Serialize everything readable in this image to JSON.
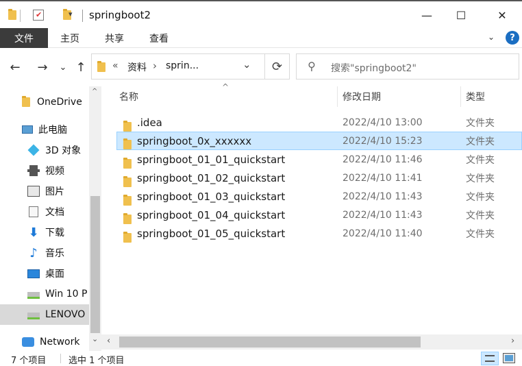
{
  "window": {
    "title": "springboot2",
    "buttons": {
      "minimize": "—",
      "maximize": "☐",
      "close": "✕"
    }
  },
  "ribbon": {
    "tabs": [
      "文件",
      "主页",
      "共享",
      "查看"
    ],
    "help": "?"
  },
  "nav": {
    "back": "←",
    "forward": "→",
    "recent": "⌄",
    "up": "↑",
    "breadcrumb_prefix": "«",
    "crumbs": [
      "资料",
      "sprin..."
    ],
    "crumb_sep": "›",
    "dropdown": "⌄",
    "refresh": "⟳"
  },
  "search": {
    "placeholder": "搜索\"springboot2\""
  },
  "sidebar": {
    "items": [
      {
        "label": "OneDrive",
        "icon": "folder-icon"
      },
      {
        "label": "此电脑",
        "icon": "computer-icon"
      },
      {
        "label": "3D 对象",
        "icon": "3d-objects-icon"
      },
      {
        "label": "视频",
        "icon": "video-icon"
      },
      {
        "label": "图片",
        "icon": "pictures-icon"
      },
      {
        "label": "文档",
        "icon": "documents-icon"
      },
      {
        "label": "下载",
        "icon": "download-icon"
      },
      {
        "label": "音乐",
        "icon": "music-icon"
      },
      {
        "label": "桌面",
        "icon": "desktop-icon"
      },
      {
        "label": "Win 10 P",
        "icon": "drive-icon"
      },
      {
        "label": "LENOVO",
        "icon": "drive-icon"
      },
      {
        "label": "Network",
        "icon": "network-icon"
      }
    ]
  },
  "list": {
    "columns": {
      "name": "名称",
      "date": "修改日期",
      "type": "类型"
    },
    "rows": [
      {
        "name": ".idea",
        "date": "2022/4/10 13:00",
        "type": "文件夹",
        "selected": false
      },
      {
        "name": "springboot_0x_xxxxxx",
        "date": "2022/4/10 15:23",
        "type": "文件夹",
        "selected": true
      },
      {
        "name": "springboot_01_01_quickstart",
        "date": "2022/4/10 11:46",
        "type": "文件夹",
        "selected": false
      },
      {
        "name": "springboot_01_02_quickstart",
        "date": "2022/4/10 11:41",
        "type": "文件夹",
        "selected": false
      },
      {
        "name": "springboot_01_03_quickstart",
        "date": "2022/4/10 11:43",
        "type": "文件夹",
        "selected": false
      },
      {
        "name": "springboot_01_04_quickstart",
        "date": "2022/4/10 11:43",
        "type": "文件夹",
        "selected": false
      },
      {
        "name": "springboot_01_05_quickstart",
        "date": "2022/4/10 11:40",
        "type": "文件夹",
        "selected": false
      }
    ]
  },
  "status": {
    "count": "7 个项目",
    "selected": "选中 1 个项目"
  },
  "colors": {
    "selection_bg": "#cce8ff",
    "selection_border": "#99d1ff",
    "folder": "#f0c04e",
    "file_tab": "#3b3b3b"
  }
}
